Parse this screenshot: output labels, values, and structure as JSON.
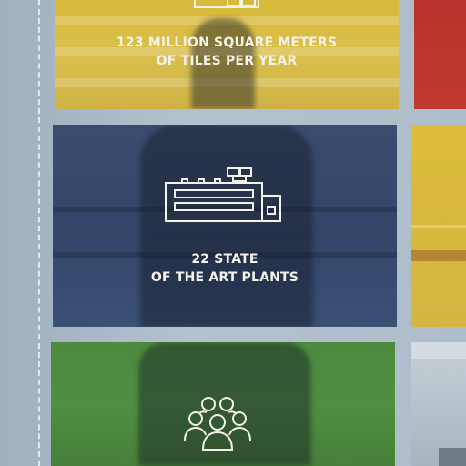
{
  "panels": {
    "tiles": {
      "line1": "123 MILLION SQUARE METERS",
      "line2": "OF TILES PER YEAR",
      "icon": "factory-icon",
      "color": "#d8b93a"
    },
    "plants": {
      "line1": "22 STATE",
      "line2": "OF THE ART PLANTS",
      "icon": "factory-icon",
      "color": "#3a4c6e"
    },
    "people": {
      "icon": "people-group-icon",
      "color": "#4d8a3e"
    }
  },
  "colors": {
    "red": "#b8312c",
    "yellow": "#dcbd3b",
    "wall": "#a9b9c6",
    "text": "#f4f2ea"
  }
}
